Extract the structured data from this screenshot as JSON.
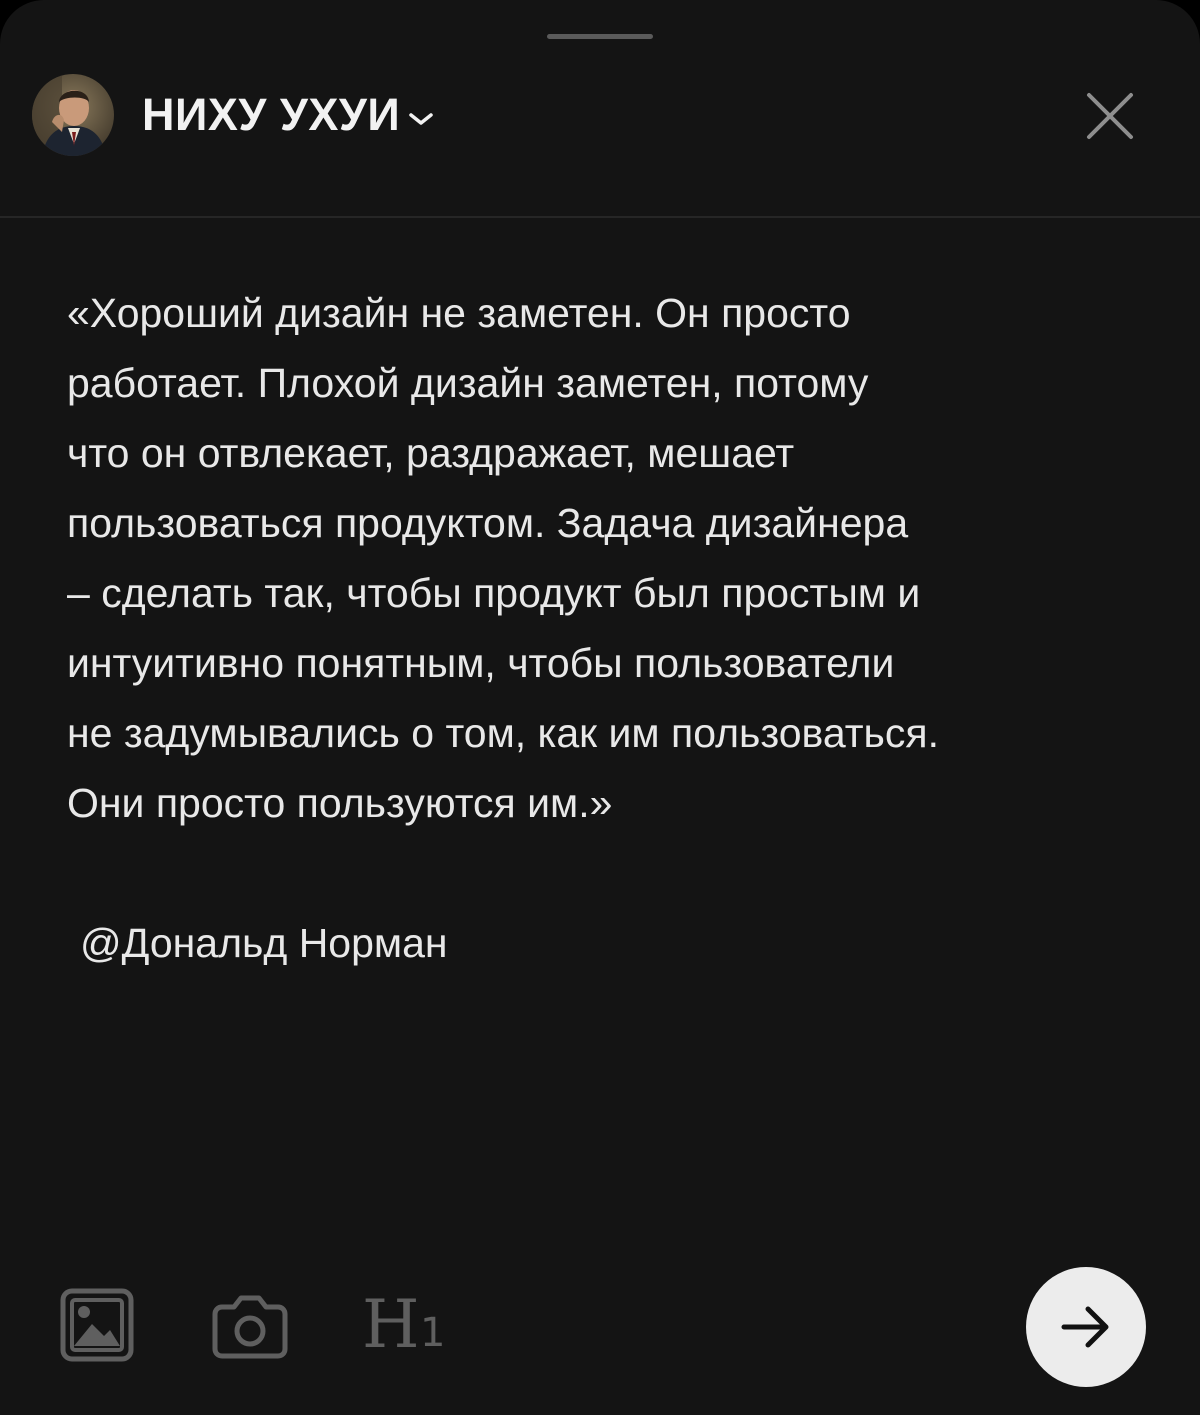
{
  "header": {
    "account_name": "НИХУ УХУИ",
    "avatar": "profile-photo",
    "chevron_icon": "chevron-down-icon",
    "close_icon": "close-icon"
  },
  "post": {
    "text": "«Хороший дизайн не заметен. Он просто\nработает. Плохой дизайн заметен, потому\nчто он отвлекает, раздражает, мешает\nпользоваться продуктом. Задача дизайнера\n– сделать так, чтобы продукт был простым и\nинтуитивно понятным, чтобы пользователи\nне задумывались о том, как им пользоваться.\nОни просто пользуются им.»",
    "signature": "@Дональд Норман"
  },
  "toolbar": {
    "gallery_icon": "image-gallery-icon",
    "camera_icon": "camera-icon",
    "heading_label": "H",
    "heading_sub": "1",
    "send_icon": "arrow-right-icon"
  },
  "colors": {
    "background": "#141414",
    "text": "#e8e8e8",
    "toolbar_icon": "#5f5f5f",
    "send_button": "#ececec"
  }
}
